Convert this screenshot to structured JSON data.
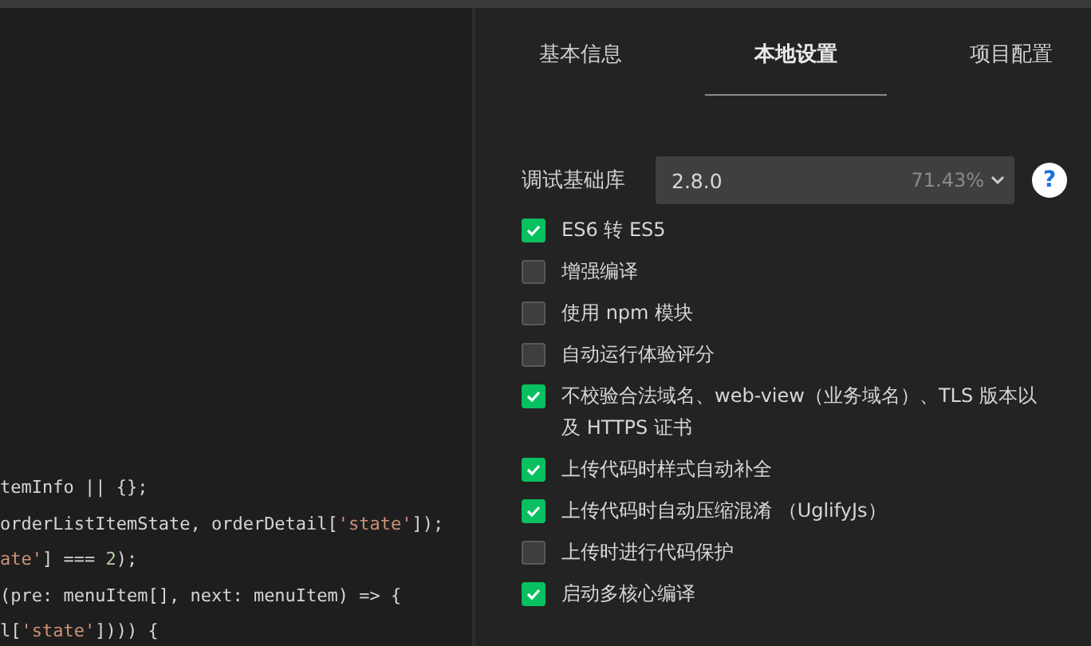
{
  "editor": {
    "lines": [
      [
        {
          "kind": "plain",
          "text": "temInfo || {};"
        }
      ],
      [
        {
          "kind": "plain",
          "text": "orderListItemState, orderDetail["
        },
        {
          "kind": "string",
          "text": "'state'"
        },
        {
          "kind": "plain",
          "text": "]);"
        }
      ],
      [
        {
          "kind": "string",
          "text": "ate'"
        },
        {
          "kind": "plain",
          "text": "] === "
        },
        {
          "kind": "number",
          "text": "2"
        },
        {
          "kind": "plain",
          "text": ");"
        }
      ],
      [
        {
          "kind": "plain",
          "text": "(pre: menuItem[], next: menuItem) => {"
        }
      ],
      [
        {
          "kind": "plain",
          "text": "l["
        },
        {
          "kind": "string",
          "text": "'state'"
        },
        {
          "kind": "plain",
          "text": "]))) {"
        }
      ]
    ]
  },
  "settings": {
    "tabs": [
      {
        "label": "基本信息",
        "selected": false
      },
      {
        "label": "本地设置",
        "selected": true
      },
      {
        "label": "项目配置",
        "selected": false
      }
    ],
    "library": {
      "label": "调试基础库",
      "value": "2.8.0",
      "percent": "71.43%",
      "help": "?"
    },
    "options": [
      {
        "label": "ES6 转 ES5",
        "checked": true
      },
      {
        "label": "增强编译",
        "checked": false
      },
      {
        "label": "使用 npm 模块",
        "checked": false
      },
      {
        "label": "自动运行体验评分",
        "checked": false
      },
      {
        "label": "不校验合法域名、web-view（业务域名）、TLS 版本以及 HTTPS 证书",
        "checked": true
      },
      {
        "label": "上传代码时样式自动补全",
        "checked": true
      },
      {
        "label": "上传代码时自动压缩混淆 （UglifyJs）",
        "checked": true
      },
      {
        "label": "上传时进行代码保护",
        "checked": false
      },
      {
        "label": "启动多核心编译",
        "checked": true
      }
    ]
  }
}
